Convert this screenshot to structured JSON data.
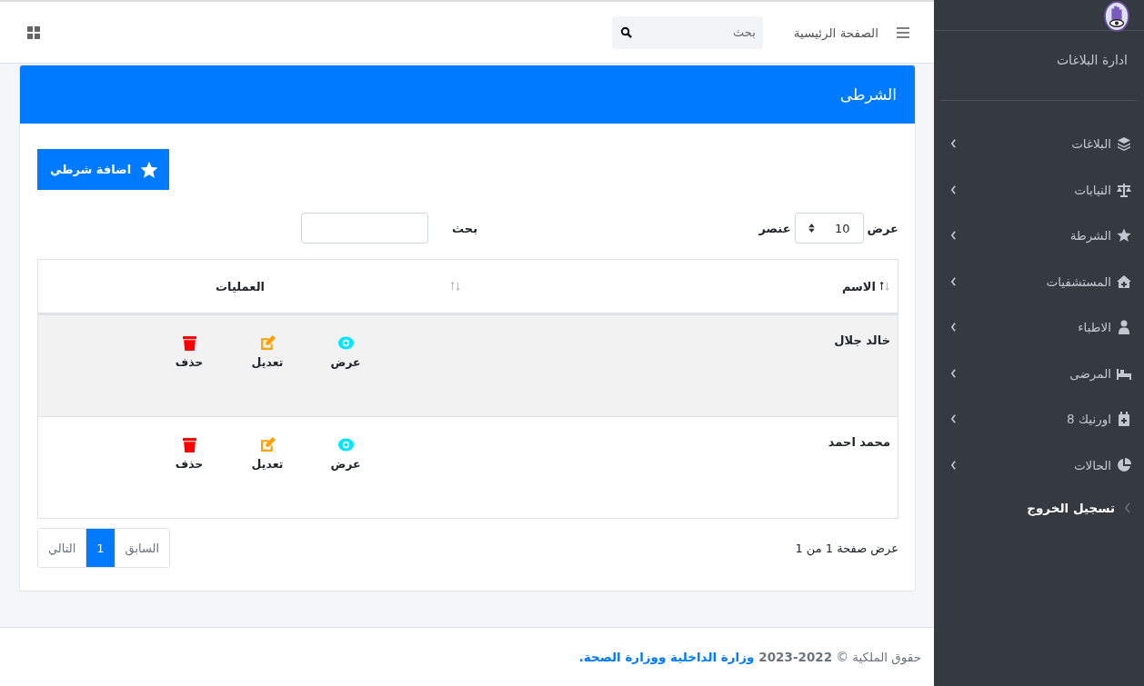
{
  "sidebar": {
    "brand": "ادارة البلاغات",
    "items": [
      {
        "label": "البلاغات",
        "expanded": false
      },
      {
        "label": "النيابات",
        "expanded": false
      },
      {
        "label": "الشرطة",
        "expanded": false
      },
      {
        "label": "المستشفيات",
        "expanded": false
      },
      {
        "label": "الاطباء",
        "expanded": false
      },
      {
        "label": "المرضى",
        "expanded": false
      },
      {
        "label": "اورنيك 8",
        "expanded": false
      },
      {
        "label": "الحالات",
        "expanded": false
      }
    ],
    "logout": "تسجيل الخروج"
  },
  "navbar": {
    "home": "الصفحة الرئيسية",
    "search": {
      "placeholder": "بحث"
    }
  },
  "card": {
    "title": "الشرطى",
    "add_button": "اضافة شرطي",
    "length": {
      "prefix": "عرض",
      "value": "10",
      "suffix": "عنصر"
    },
    "search_label": "بحث",
    "table": {
      "columns": [
        {
          "label": "الاسم",
          "sorted": true
        },
        {
          "label": "العمليات",
          "sorted": false
        }
      ],
      "rows": [
        {
          "name": "خالد جلال",
          "actions": [
            {
              "kind": "view",
              "label": "عرض"
            },
            {
              "kind": "edit",
              "label": "تعديل"
            },
            {
              "kind": "delete",
              "label": "حذف"
            }
          ]
        },
        {
          "name": "محمد احمد",
          "actions": [
            {
              "kind": "view",
              "label": "عرض"
            },
            {
              "kind": "edit",
              "label": "تعديل"
            },
            {
              "kind": "delete",
              "label": "حذف"
            }
          ]
        }
      ]
    },
    "info": "عرض صفحة 1 من 1",
    "pagination": [
      {
        "label": "السابق",
        "selected": false,
        "disabled": true
      },
      {
        "label": "1",
        "selected": true,
        "disabled": false
      },
      {
        "label": "التالي",
        "selected": false,
        "disabled": true
      }
    ]
  },
  "footer": {
    "prefix": "حقوق الملكية © **2022-2023**",
    "link": "وزارة الداخلية ووزارة الصحة."
  }
}
